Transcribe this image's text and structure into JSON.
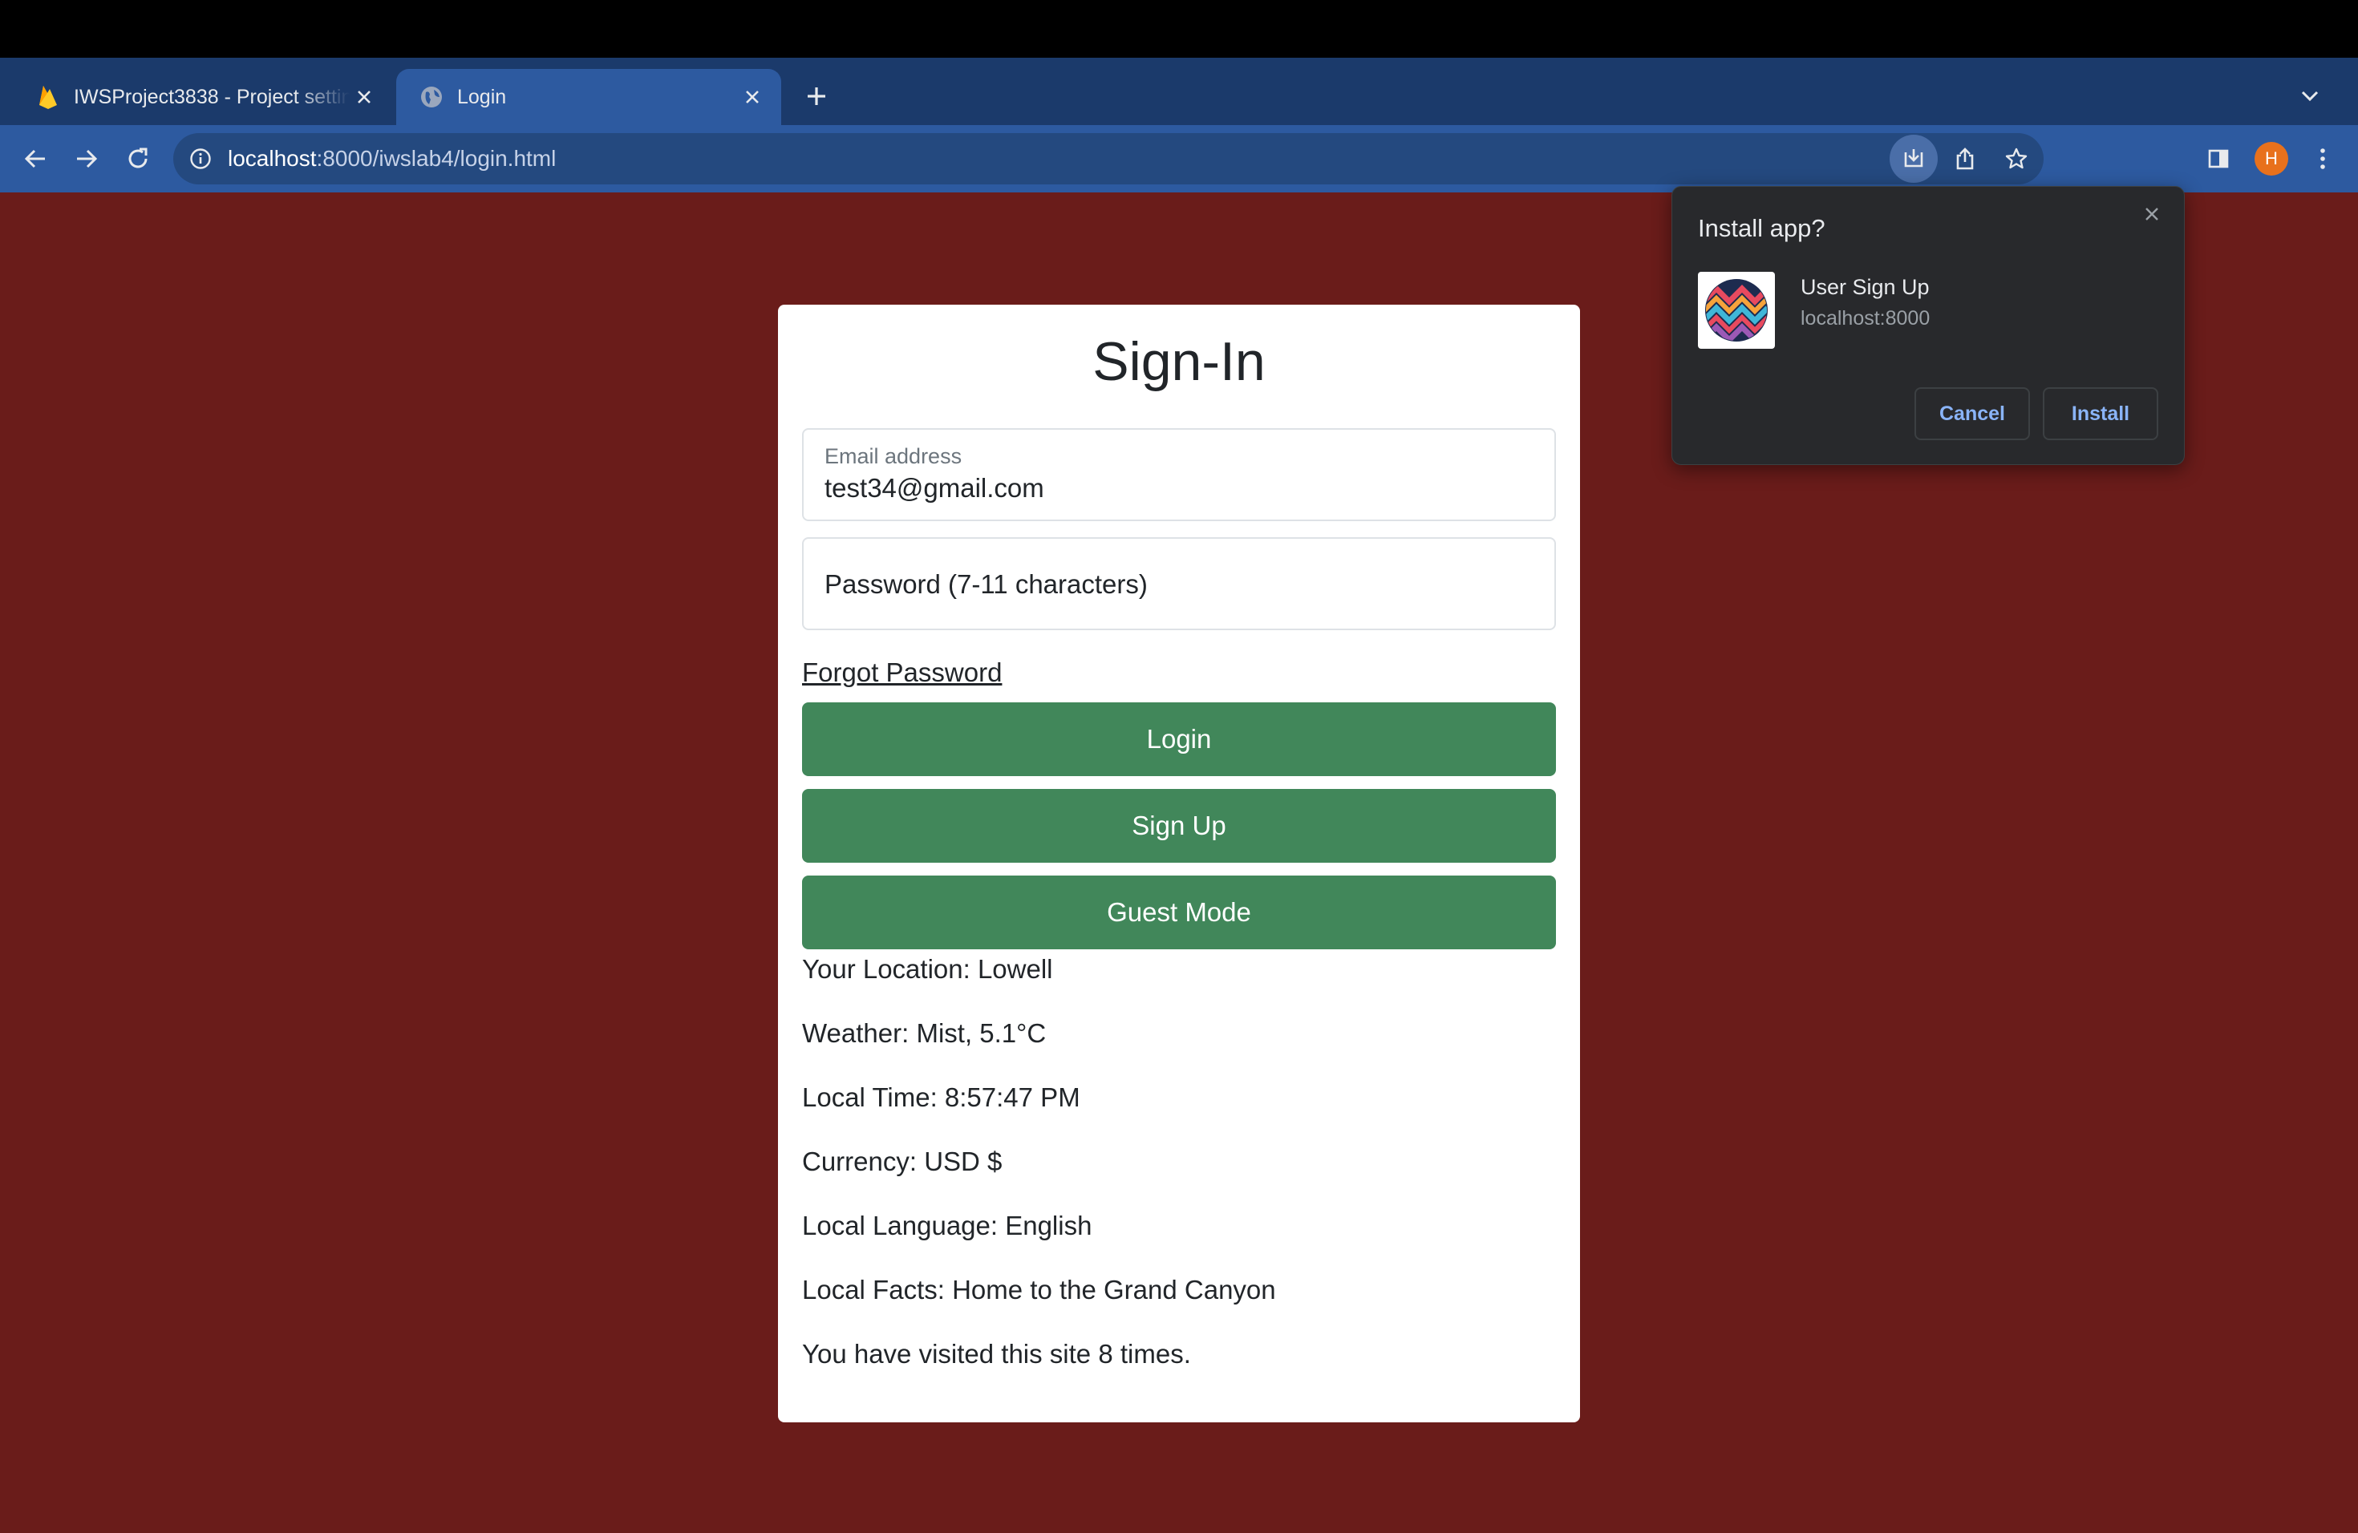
{
  "browser": {
    "tabs": [
      {
        "title": "IWSProject3838 - Project settings",
        "favicon": "firebase-icon",
        "active": false
      },
      {
        "title": "Login",
        "favicon": "globe-icon",
        "active": true
      }
    ],
    "url_host": "localhost",
    "url_path": ":8000/iwslab4/login.html",
    "profile_initial": "H",
    "colors": {
      "tabstrip": "#1b3a6b",
      "toolbar": "#2d5aa0",
      "avatar": "#e8711c"
    }
  },
  "page": {
    "background_color": "#6a1c1a",
    "title": "Sign-In",
    "email": {
      "label": "Email address",
      "value": "test34@gmail.com"
    },
    "password": {
      "placeholder": "Password (7-11 characters)"
    },
    "forgot_label": "Forgot Password",
    "buttons": {
      "login": "Login",
      "signup": "Sign Up",
      "guest": "Guest Mode"
    },
    "button_color": "#41875a",
    "info": {
      "location": "Your Location: Lowell",
      "weather": "Weather: Mist, 5.1°C",
      "time": "Local Time: 8:57:47 PM",
      "currency": "Currency: USD $",
      "language": "Local Language: English",
      "facts": "Local Facts: Home to the Grand Canyon",
      "visits": "You have visited this site 8 times."
    }
  },
  "install_popup": {
    "title": "Install app?",
    "app_name": "User Sign Up",
    "app_origin": "localhost:8000",
    "cancel_label": "Cancel",
    "install_label": "Install"
  }
}
